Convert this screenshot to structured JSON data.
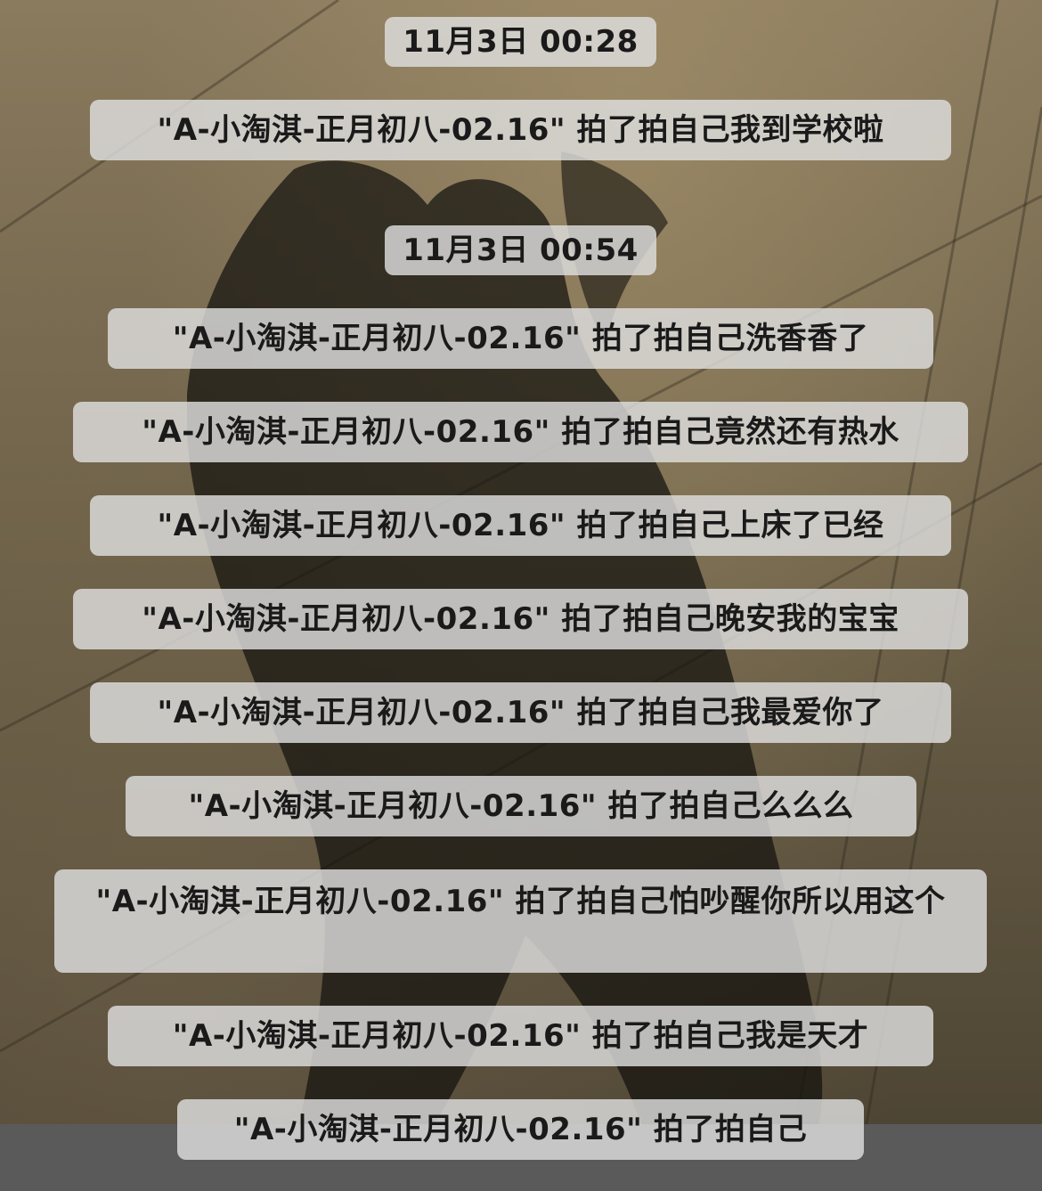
{
  "background": {
    "scene": "shadow-on-tiles",
    "bottom_bar_color": "#5a5a5a"
  },
  "chat": {
    "timestamps": [
      "11月3日 00:28",
      "11月3日 00:54"
    ],
    "messages": [
      "\"A-小淘淇-正月初八-02.16\" 拍了拍自己我到学校啦",
      "\"A-小淘淇-正月初八-02.16\" 拍了拍自己洗香香了",
      "\"A-小淘淇-正月初八-02.16\" 拍了拍自己竟然还有热水",
      "\"A-小淘淇-正月初八-02.16\" 拍了拍自己上床了已经",
      "\"A-小淘淇-正月初八-02.16\" 拍了拍自己晚安我的宝宝",
      "\"A-小淘淇-正月初八-02.16\" 拍了拍自己我最爱你了",
      "\"A-小淘淇-正月初八-02.16\" 拍了拍自己么么么",
      "\"A-小淘淇-正月初八-02.16\" 拍了拍自己怕吵醒你所以用这个",
      "\"A-小淘淇-正月初八-02.16\" 拍了拍自己我是天才",
      "\"A-小淘淇-正月初八-02.16\" 拍了拍自己"
    ]
  }
}
